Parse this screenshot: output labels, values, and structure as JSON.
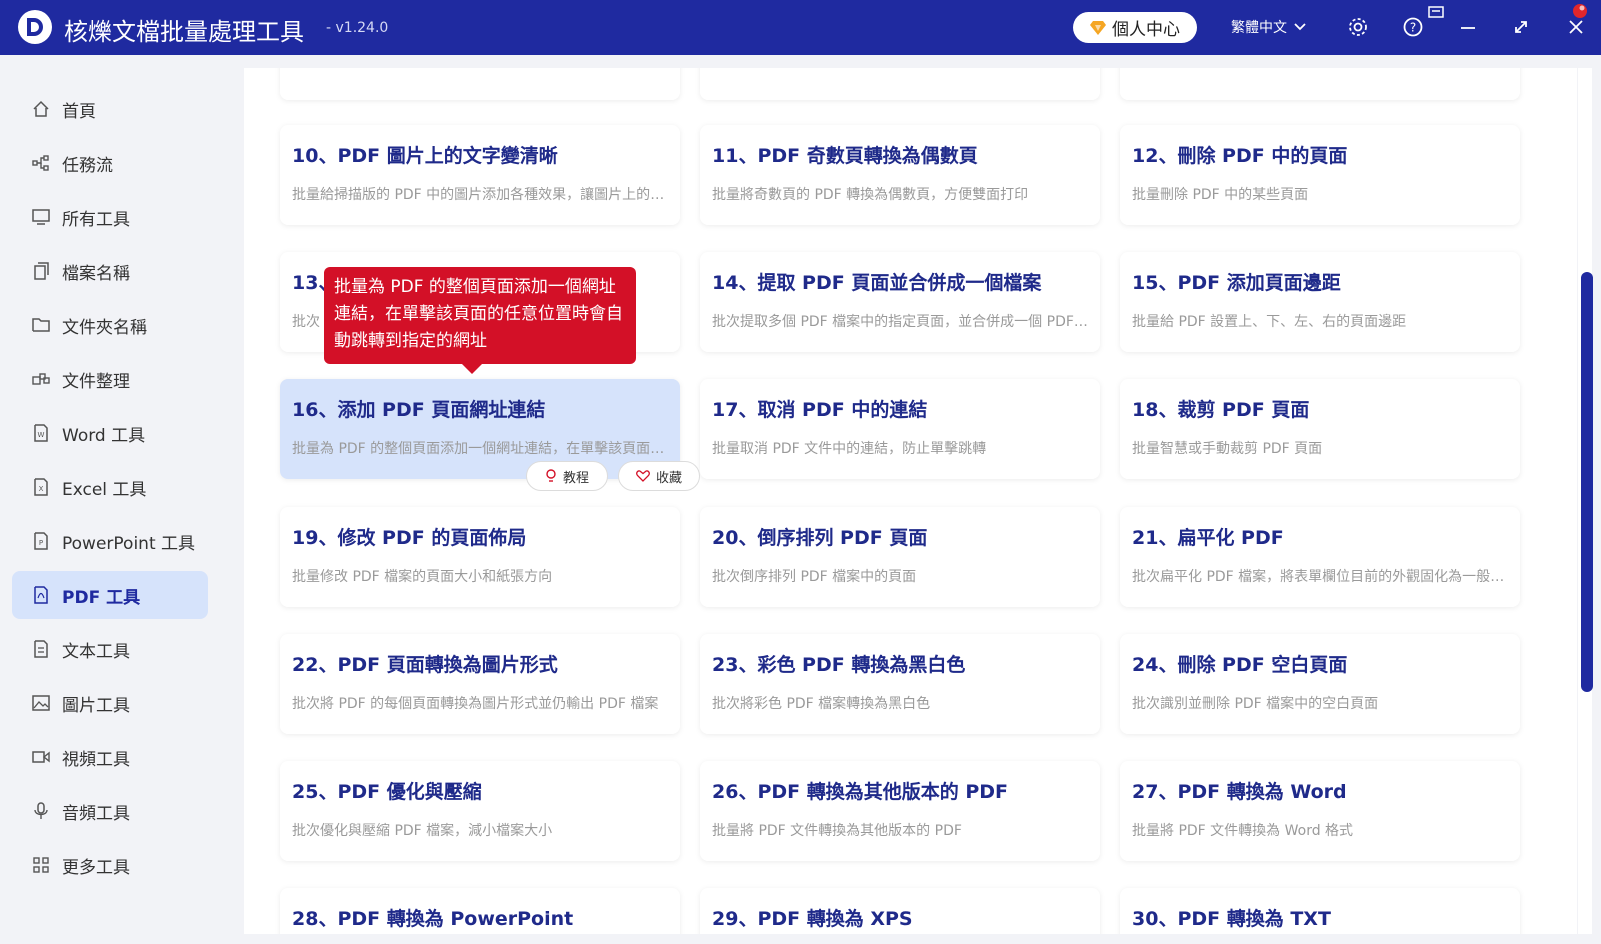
{
  "titlebar": {
    "app_name": "核爍文檔批量處理工具",
    "version": "- v1.24.0",
    "user_center": "個人中心",
    "language": "繁體中文"
  },
  "sidebar": {
    "items": [
      {
        "label": "首頁",
        "icon": "home-icon"
      },
      {
        "label": "任務流",
        "icon": "workflow-icon"
      },
      {
        "label": "所有工具",
        "icon": "monitor-icon"
      },
      {
        "label": "檔案名稱",
        "icon": "file-copy-icon"
      },
      {
        "label": "文件夾名稱",
        "icon": "folder-icon"
      },
      {
        "label": "文件整理",
        "icon": "organize-icon"
      },
      {
        "label": "Word 工具",
        "icon": "word-file-icon"
      },
      {
        "label": "Excel 工具",
        "icon": "excel-file-icon"
      },
      {
        "label": "PowerPoint 工具",
        "icon": "ppt-file-icon"
      },
      {
        "label": "PDF 工具",
        "icon": "pdf-file-icon",
        "active": true
      },
      {
        "label": "文本工具",
        "icon": "text-file-icon"
      },
      {
        "label": "圖片工具",
        "icon": "image-icon"
      },
      {
        "label": "視頻工具",
        "icon": "video-icon"
      },
      {
        "label": "音頻工具",
        "icon": "microphone-icon"
      },
      {
        "label": "更多工具",
        "icon": "grid-icon"
      }
    ]
  },
  "cards": [
    {
      "title": "10、PDF 圖片上的文字變清晰",
      "desc": "批量給掃描版的 PDF 中的圖片添加各種效果，讓圖片上的文字變得更清晰"
    },
    {
      "title": "11、PDF 奇數頁轉換為偶數頁",
      "desc": "批量將奇數頁的 PDF 轉換為偶數頁，方便雙面打印"
    },
    {
      "title": "12、刪除 PDF 中的頁面",
      "desc": "批量刪除 PDF 中的某些頁面"
    },
    {
      "title": "13、",
      "desc": "批次"
    },
    {
      "title": "14、提取 PDF 頁面並合併成一個檔案",
      "desc": "批次提取多個 PDF 檔案中的指定頁面，並合併成一個 PDF 檔案"
    },
    {
      "title": "15、PDF 添加頁面邊距",
      "desc": "批量給 PDF 設置上、下、左、右的頁面邊距"
    },
    {
      "title": "16、添加 PDF 頁面網址連結",
      "desc": "批量為 PDF 的整個頁面添加一個網址連結，在單擊該頁面的任意位置時會自動跳轉"
    },
    {
      "title": "17、取消 PDF 中的連結",
      "desc": "批量取消 PDF 文件中的連結，防止單擊跳轉"
    },
    {
      "title": "18、裁剪 PDF 頁面",
      "desc": "批量智慧或手動裁剪 PDF 頁面"
    },
    {
      "title": "19、修改 PDF 的頁面佈局",
      "desc": "批量修改 PDF 檔案的頁面大小和紙張方向"
    },
    {
      "title": "20、倒序排列 PDF 頁面",
      "desc": "批次倒序排列 PDF 檔案中的頁面"
    },
    {
      "title": "21、扁平化 PDF",
      "desc": "批次扁平化 PDF 檔案，將表單欄位目前的外觀固化為一般內容"
    },
    {
      "title": "22、PDF 頁面轉換為圖片形式",
      "desc": "批次將 PDF 的每個頁面轉換為圖片形式並仍輸出 PDF 檔案"
    },
    {
      "title": "23、彩色 PDF 轉換為黑白色",
      "desc": "批次將彩色 PDF 檔案轉換為黑白色"
    },
    {
      "title": "24、刪除 PDF 空白頁面",
      "desc": "批次識別並刪除 PDF 檔案中的空白頁面"
    },
    {
      "title": "25、PDF 優化與壓縮",
      "desc": "批次優化與壓縮 PDF 檔案，減小檔案大小"
    },
    {
      "title": "26、PDF 轉換為其他版本的 PDF",
      "desc": "批量將 PDF 文件轉換為其他版本的 PDF"
    },
    {
      "title": "27、PDF 轉換為 Word",
      "desc": "批量將 PDF 文件轉換為 Word 格式"
    },
    {
      "title": "28、PDF 轉換為 PowerPoint",
      "desc": ""
    },
    {
      "title": "29、PDF 轉換為 XPS",
      "desc": ""
    },
    {
      "title": "30、PDF 轉換為 TXT",
      "desc": ""
    }
  ],
  "card_actions": {
    "tutorial": "教程",
    "favorite": "收藏"
  },
  "tooltip": {
    "text": "批量為 PDF 的整個頁面添加一個網址連結，在單擊該頁面的任意位置時會自動跳轉到指定的網址"
  },
  "colors": {
    "brand": "#1f2aa0",
    "tooltip": "#d31027",
    "active_bg": "#d6e3fb"
  }
}
